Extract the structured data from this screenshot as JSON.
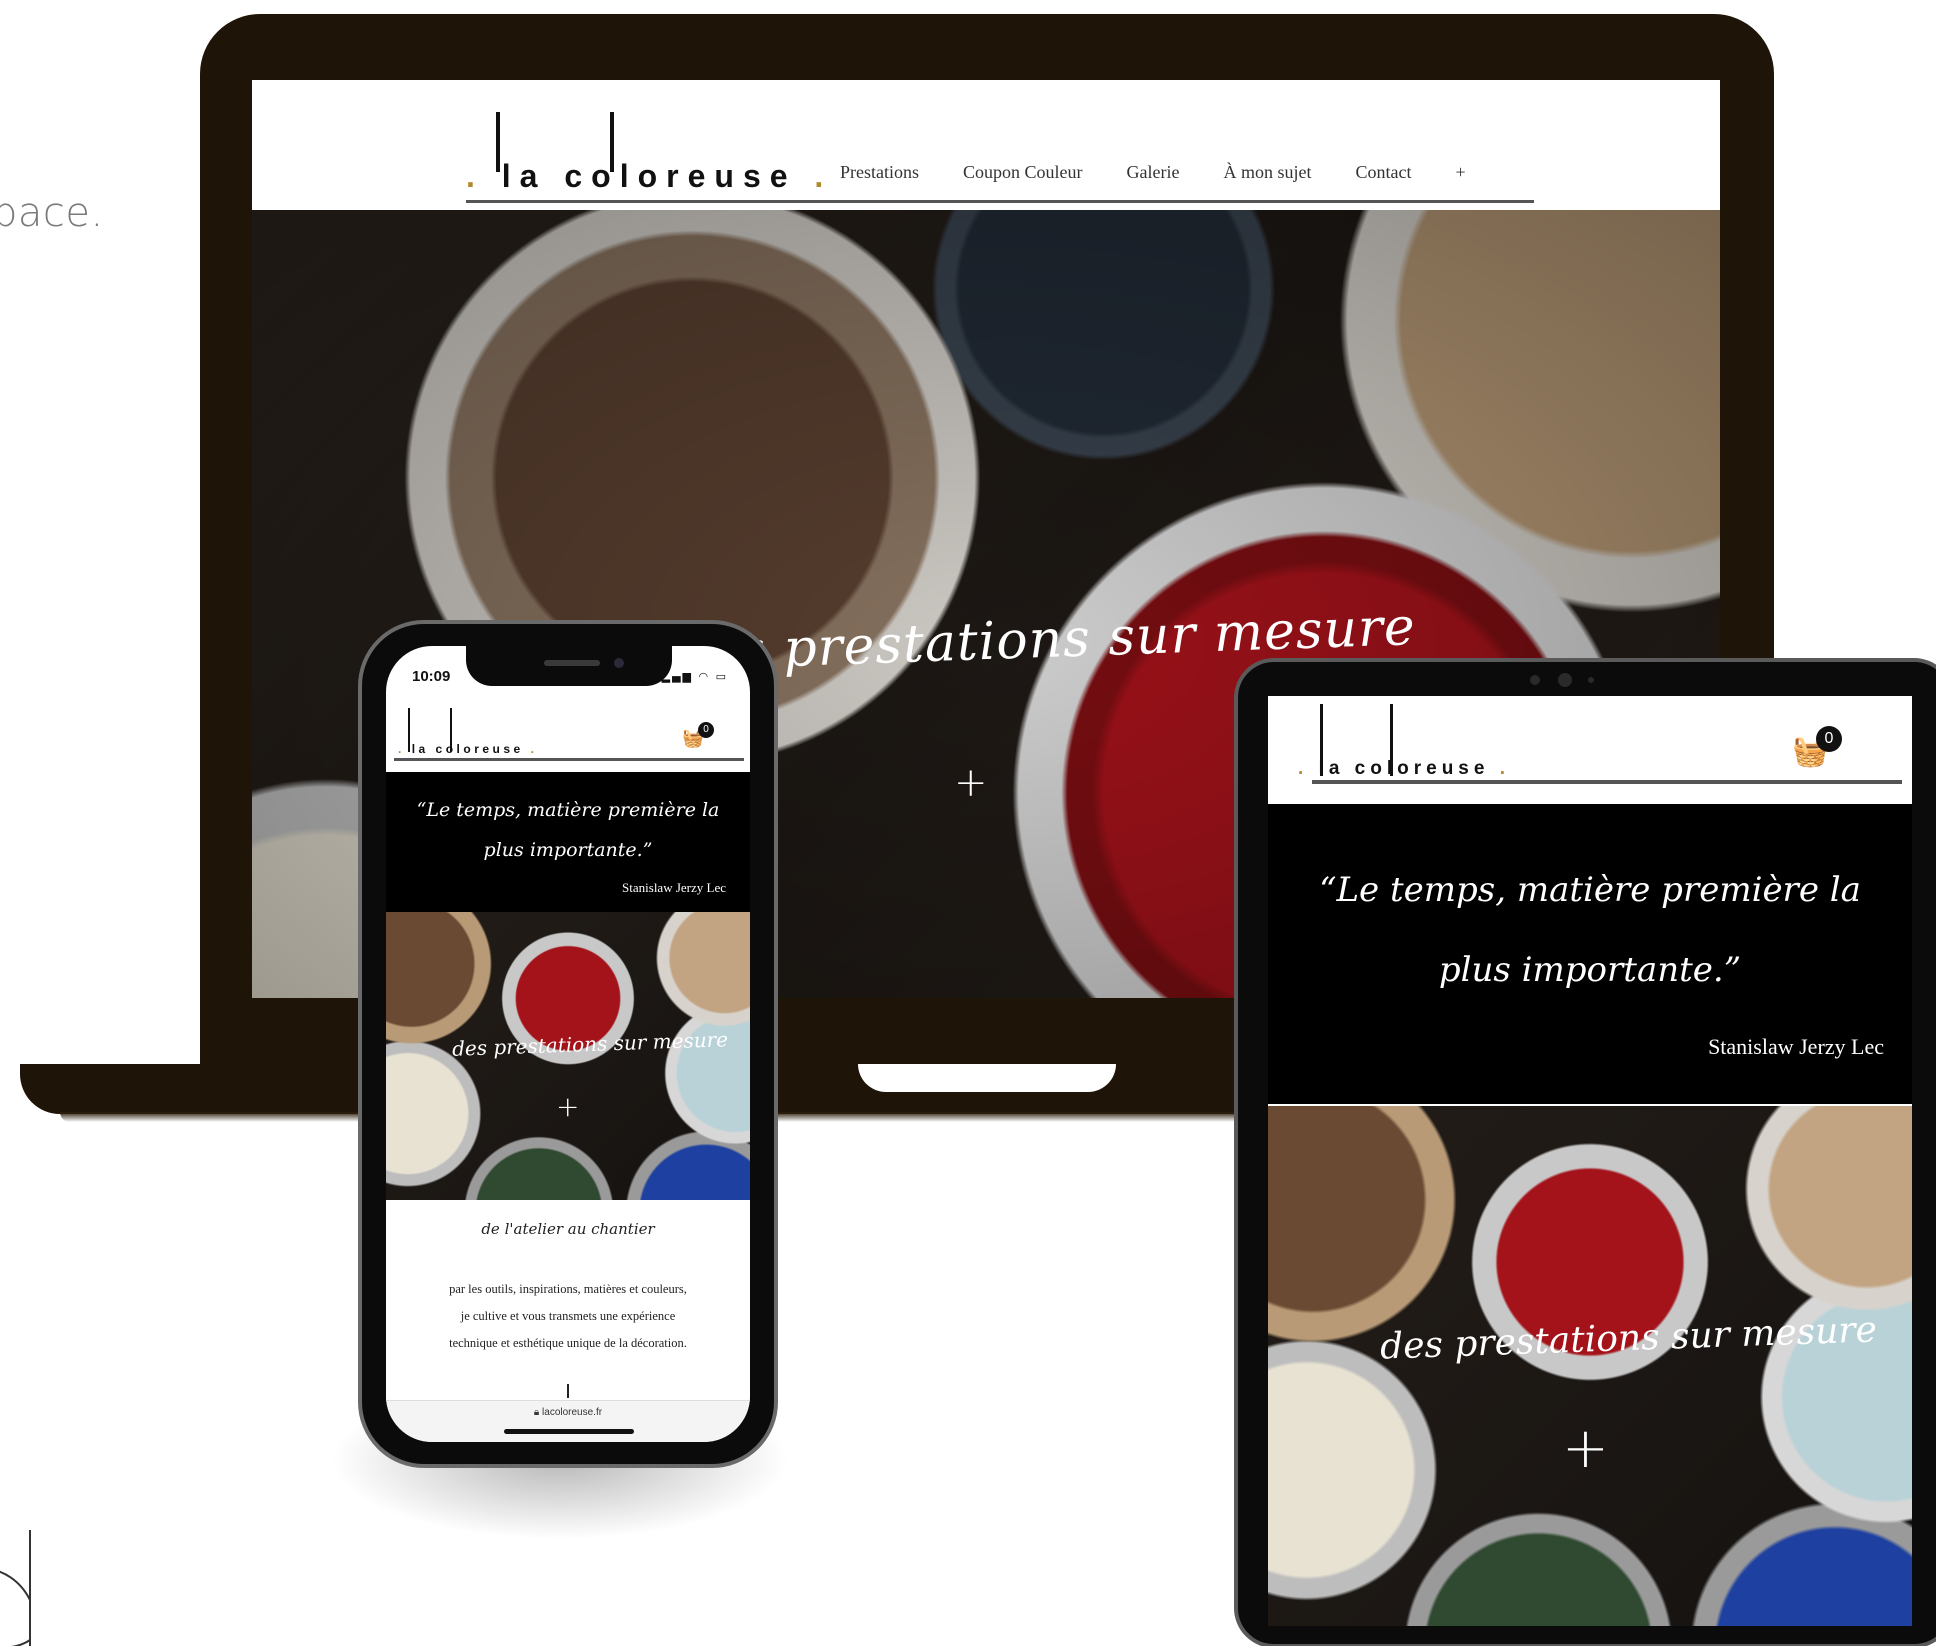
{
  "background": {
    "fragment_text": "pace."
  },
  "brand": {
    "logo_text": "la coloreuse",
    "accent_color": "#b08a2e",
    "device_frame_color": "#1e1407"
  },
  "desktop": {
    "nav": [
      "Prestations",
      "Coupon Couleur",
      "Galerie",
      "À mon sujet",
      "Contact",
      "+"
    ],
    "hero_title": "des prestations sur mesure",
    "hero_plus": "+"
  },
  "phone": {
    "status_time": "10:09",
    "cart_count": "0",
    "quote": "“Le temps, matière première la plus importante.”",
    "quote_author": "Stanislaw Jerzy Lec",
    "hero_title": "des prestations sur mesure",
    "hero_plus": "+",
    "subtitle": "de l'atelier au chantier",
    "description_lines": [
      "par les outils, inspirations, matières et couleurs,",
      "je cultive et vous transmets une expérience",
      "technique et esthétique unique de la décoration."
    ],
    "url": "lacoloreuse.fr"
  },
  "tablet": {
    "cart_count": "0",
    "quote": "“Le temps, matière première la plus importante.”",
    "quote_author": "Stanislaw Jerzy Lec",
    "hero_title": "des prestations sur mesure",
    "hero_plus": "+"
  }
}
